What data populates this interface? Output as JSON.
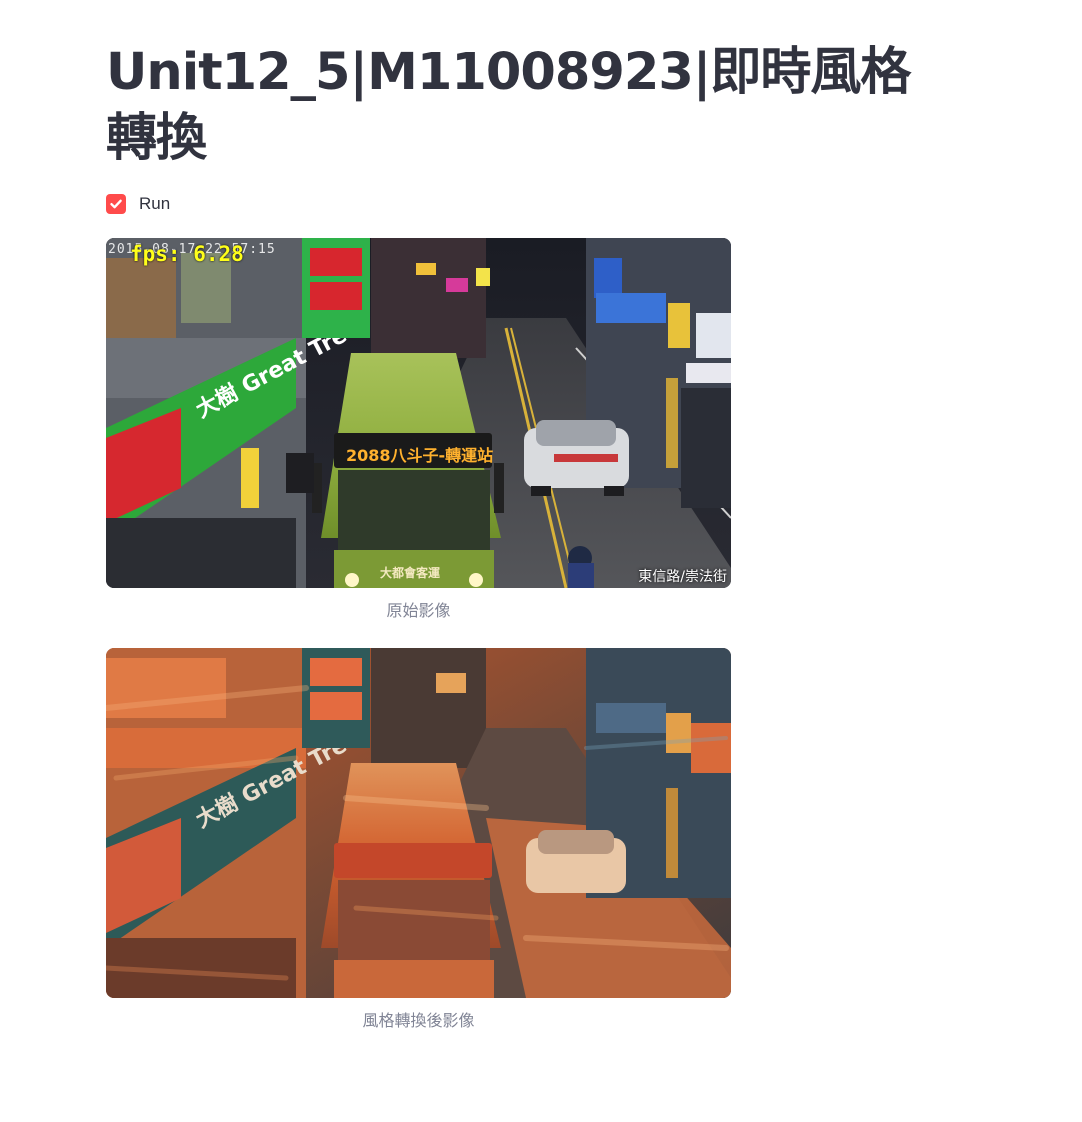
{
  "page": {
    "title": "Unit12_5|M11008923|即時風格轉換"
  },
  "run_checkbox": {
    "label": "Run",
    "checked": true,
    "accent_color": "#ff4b4b"
  },
  "original_image": {
    "caption": "原始影像",
    "fps_text": "fps: 6.28",
    "timestamp_text": "2015-08-17 22:57:15",
    "street_label": "東信路/崇法街",
    "bus_sign": "2088八斗子-轉運站",
    "bus_company": "大都會客運"
  },
  "styled_image": {
    "caption": "風格轉換後影像"
  }
}
